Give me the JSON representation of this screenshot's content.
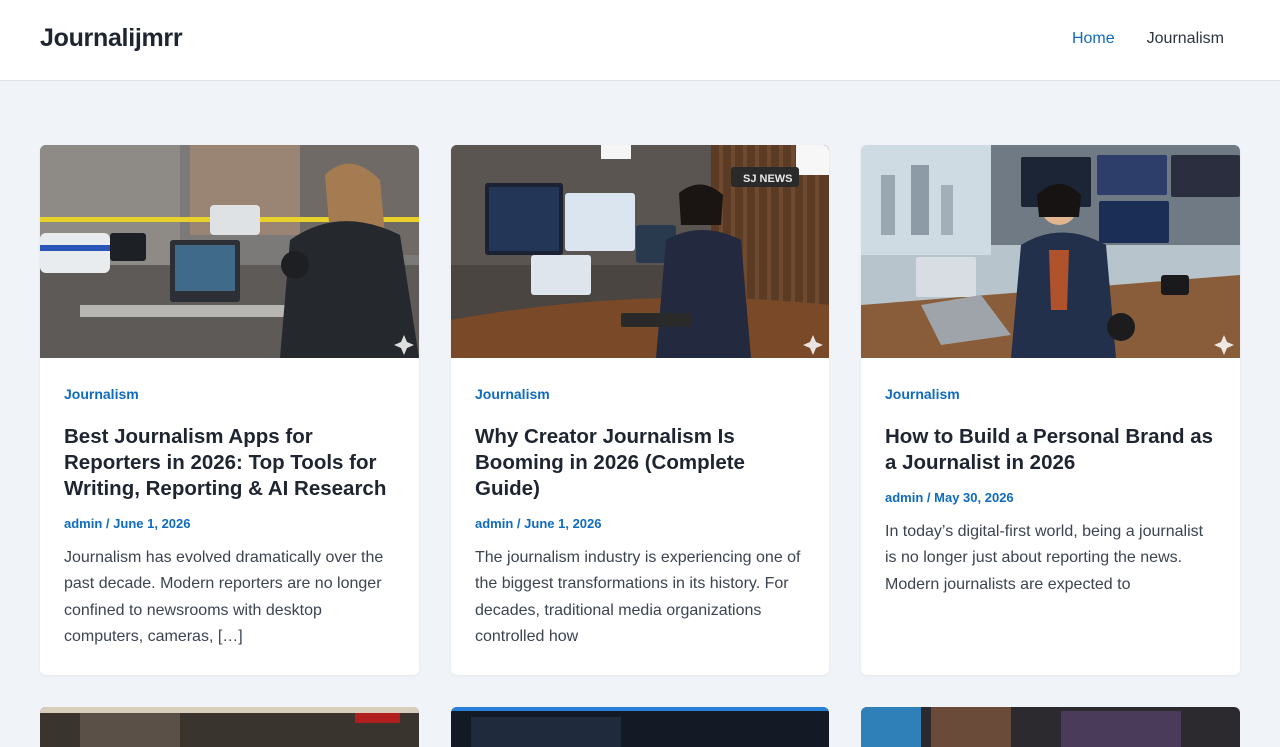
{
  "site": {
    "title": "Journalijmrr"
  },
  "nav": {
    "items": [
      {
        "label": "Home",
        "active": true
      },
      {
        "label": "Journalism",
        "active": false
      }
    ]
  },
  "posts": [
    {
      "category": "Journalism",
      "title": "Best Journalism Apps for Reporters in 2026: Top Tools for Writing, Reporting & AI Research",
      "author": "admin",
      "date": "June 1, 2026",
      "excerpt": "Journalism has evolved dramatically over the past decade. Modern reporters are no longer confined to newsrooms with desktop computers, cameras, […]",
      "image_subject": "reporter-on-street-with-laptop"
    },
    {
      "category": "Journalism",
      "title": "Why Creator Journalism Is Booming in 2026 (Complete Guide)",
      "author": "admin",
      "date": "June 1, 2026",
      "excerpt": "The journalism industry is experiencing one of the biggest transformations in its history. For decades, traditional media organizations controlled how",
      "image_subject": "creator-studio-with-monitors",
      "image_text": "SJ NEWS"
    },
    {
      "category": "Journalism",
      "title": "How to Build a Personal Brand as a Journalist in 2026",
      "author": "admin",
      "date": "May 30, 2026",
      "excerpt": "In today’s digital-first world, being a journalist is no longer just about reporting the news. Modern journalists are expected to",
      "image_subject": "journalist-in-newsroom-office"
    }
  ],
  "colors": {
    "accent": "#0f6bbf",
    "background": "#f0f4f8",
    "card": "#ffffff",
    "text": "#1e2530"
  }
}
